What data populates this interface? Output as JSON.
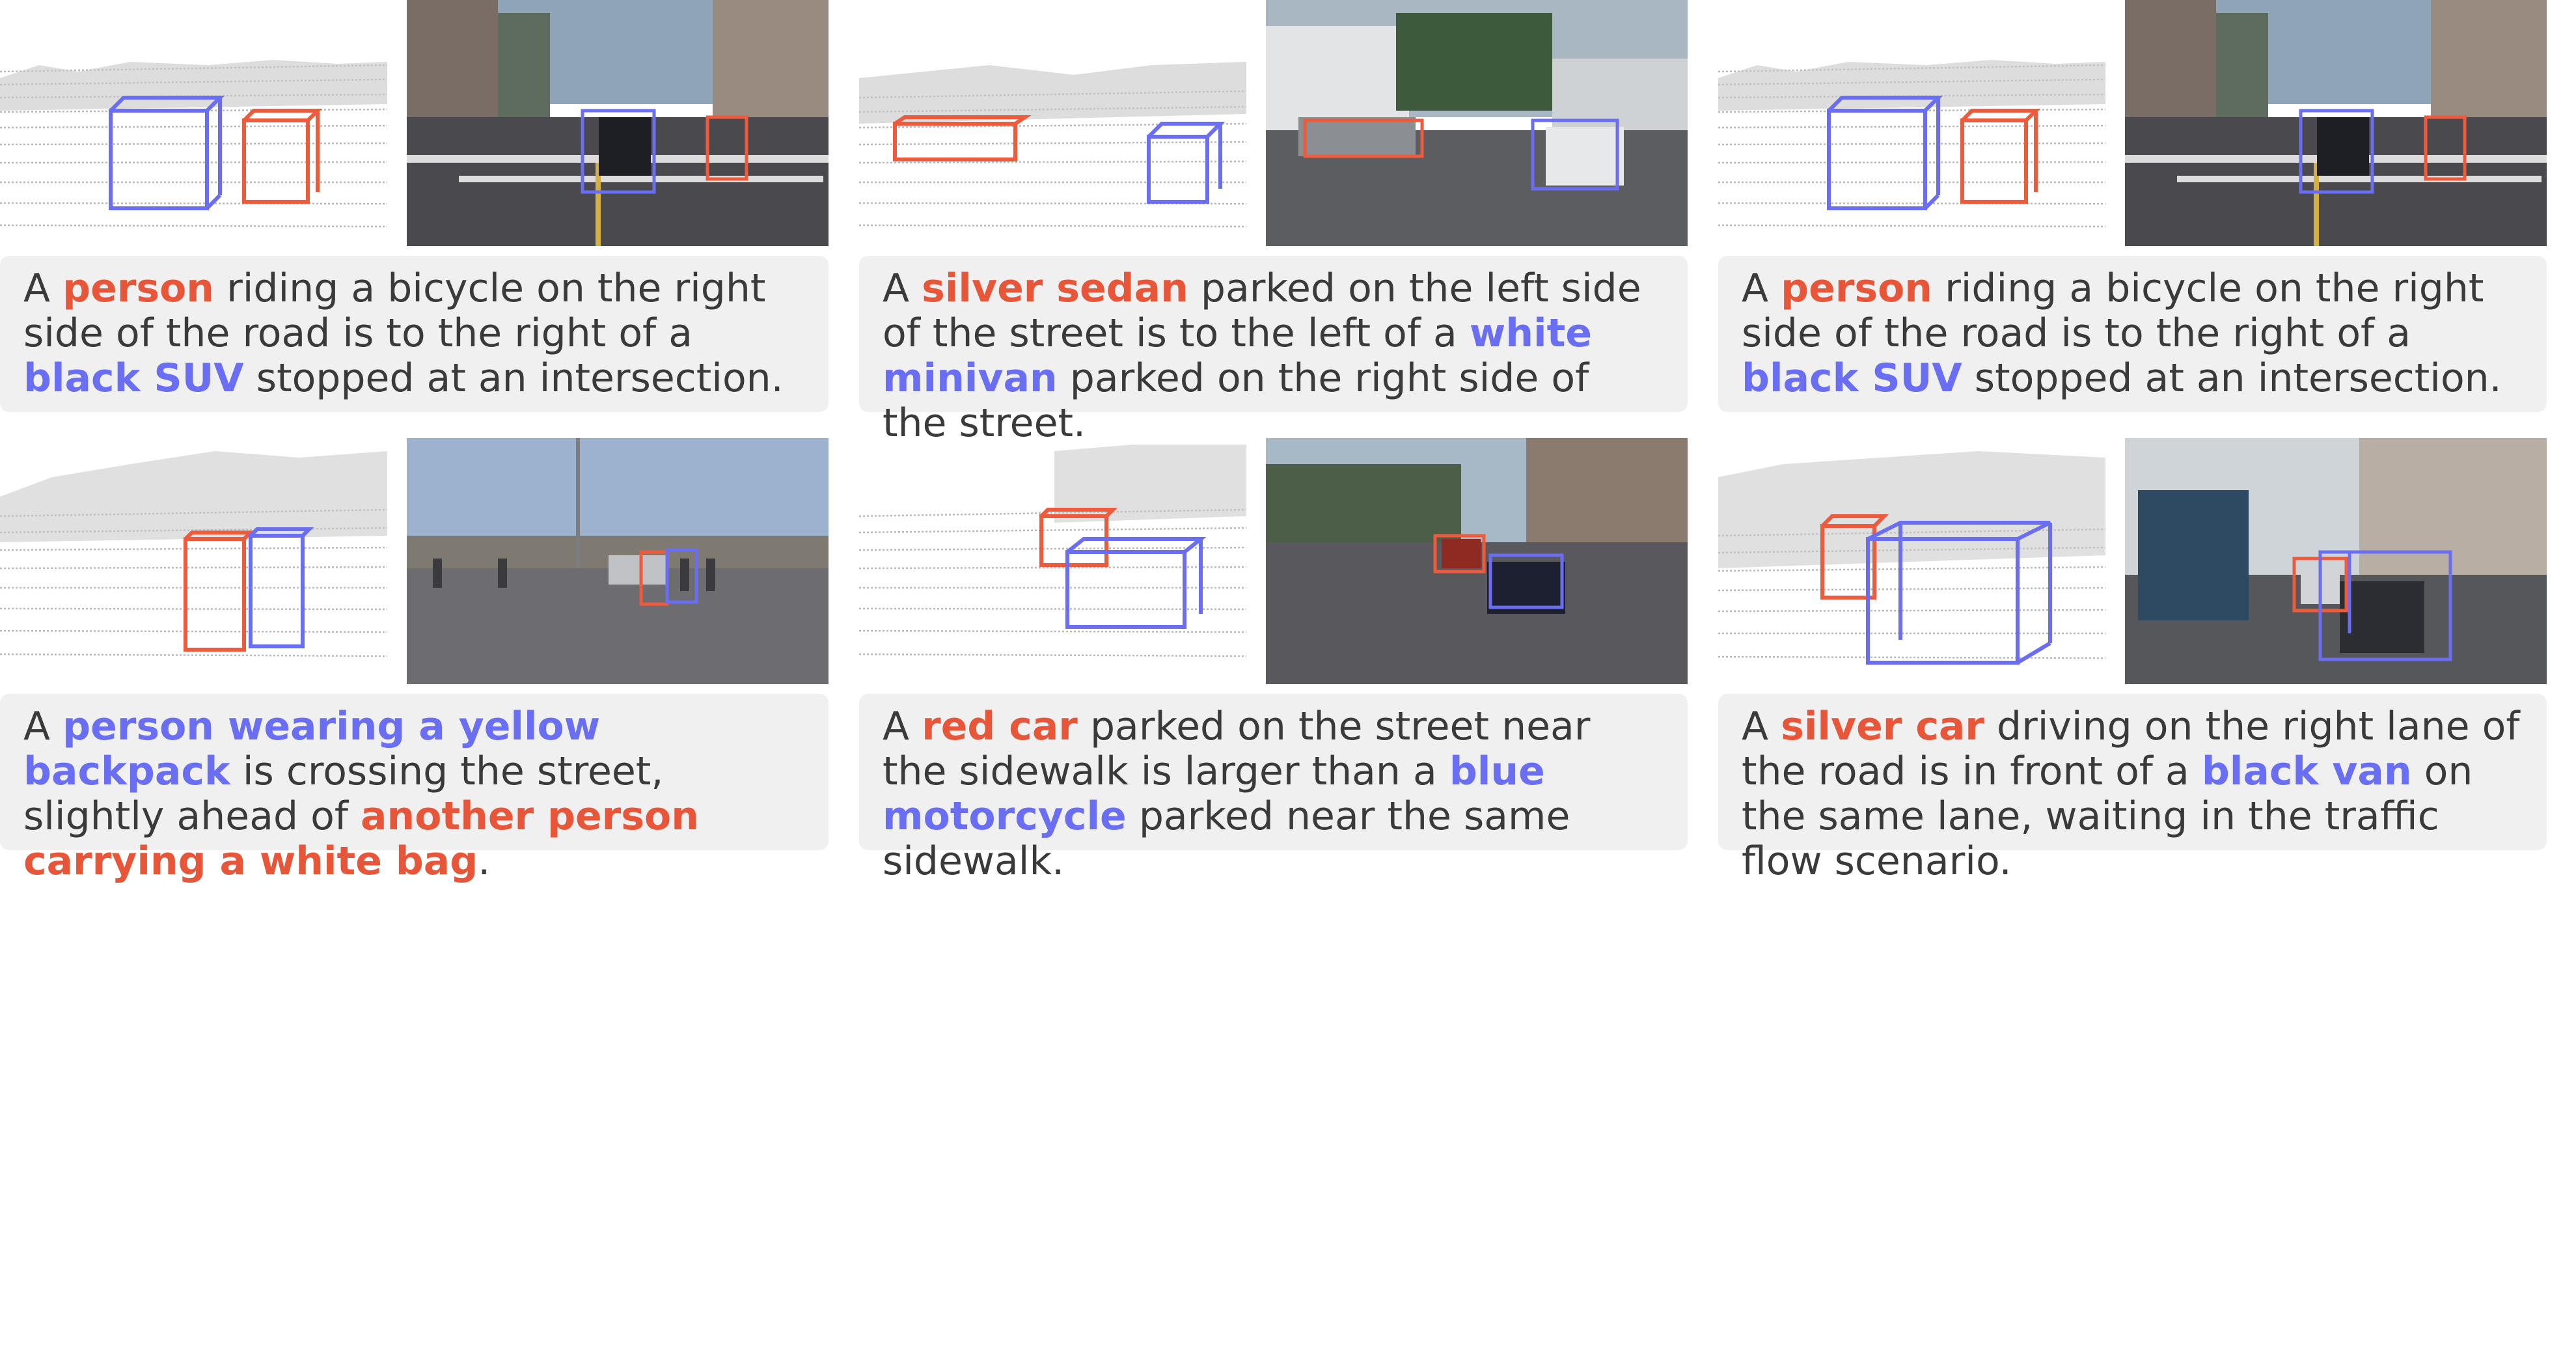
{
  "colors": {
    "red_box": "#ee5a3c",
    "blue_box": "#6a6ef2",
    "caption_bg": "#f0f0f0",
    "caption_text": "#3a3a3a"
  },
  "panels": [
    {
      "caption": {
        "a": "A ",
        "target": "person",
        "mid1": " riding a bicycle on the right side of the road is to the right of a ",
        "anchor": "black SUV",
        "mid2": " stopped at an intersection.",
        "target_color": "red",
        "anchor_color": "blue"
      },
      "lidar_image": "lidar-point-cloud",
      "camera_image": "street-intersection-photo"
    },
    {
      "caption": {
        "a": "A ",
        "target": "silver sedan",
        "mid1": " parked on the left side of the street is to the left of a ",
        "anchor": "white minivan",
        "mid2": " parked on the right side of the street.",
        "target_color": "red",
        "anchor_color": "blue"
      },
      "lidar_image": "lidar-point-cloud",
      "camera_image": "residential-street-photo"
    },
    {
      "caption": {
        "a": "A ",
        "target": "person",
        "mid1": " riding a bicycle on the right side of the road is to the right of a ",
        "anchor": "black SUV",
        "mid2": " stopped at an intersection.",
        "target_color": "red",
        "anchor_color": "blue"
      },
      "lidar_image": "lidar-point-cloud",
      "camera_image": "street-intersection-photo"
    },
    {
      "caption": {
        "a": "A ",
        "target": "person wearing a yellow backpack",
        "mid1": " is crossing the street, slightly ahead of ",
        "anchor": "another person carrying a white bag",
        "mid2": ".",
        "target_color": "blue",
        "anchor_color": "red"
      },
      "lidar_image": "lidar-point-cloud",
      "camera_image": "pedestrian-crossing-photo"
    },
    {
      "caption": {
        "a": "A ",
        "target": "red car",
        "mid1": " parked on the street near the sidewalk is larger than a ",
        "anchor": "blue motorcycle",
        "mid2": " parked near the same sidewalk.",
        "target_color": "red",
        "anchor_color": "blue"
      },
      "lidar_image": "lidar-point-cloud",
      "camera_image": "parked-vehicles-photo"
    },
    {
      "caption": {
        "a": "A ",
        "target": "silver car",
        "mid1": " driving on the right lane of the road is in front of a ",
        "anchor": "black van",
        "mid2": " on the same lane, waiting in the traffic flow scenario.",
        "target_color": "red",
        "anchor_color": "blue"
      },
      "lidar_image": "lidar-point-cloud",
      "camera_image": "city-traffic-photo"
    }
  ]
}
